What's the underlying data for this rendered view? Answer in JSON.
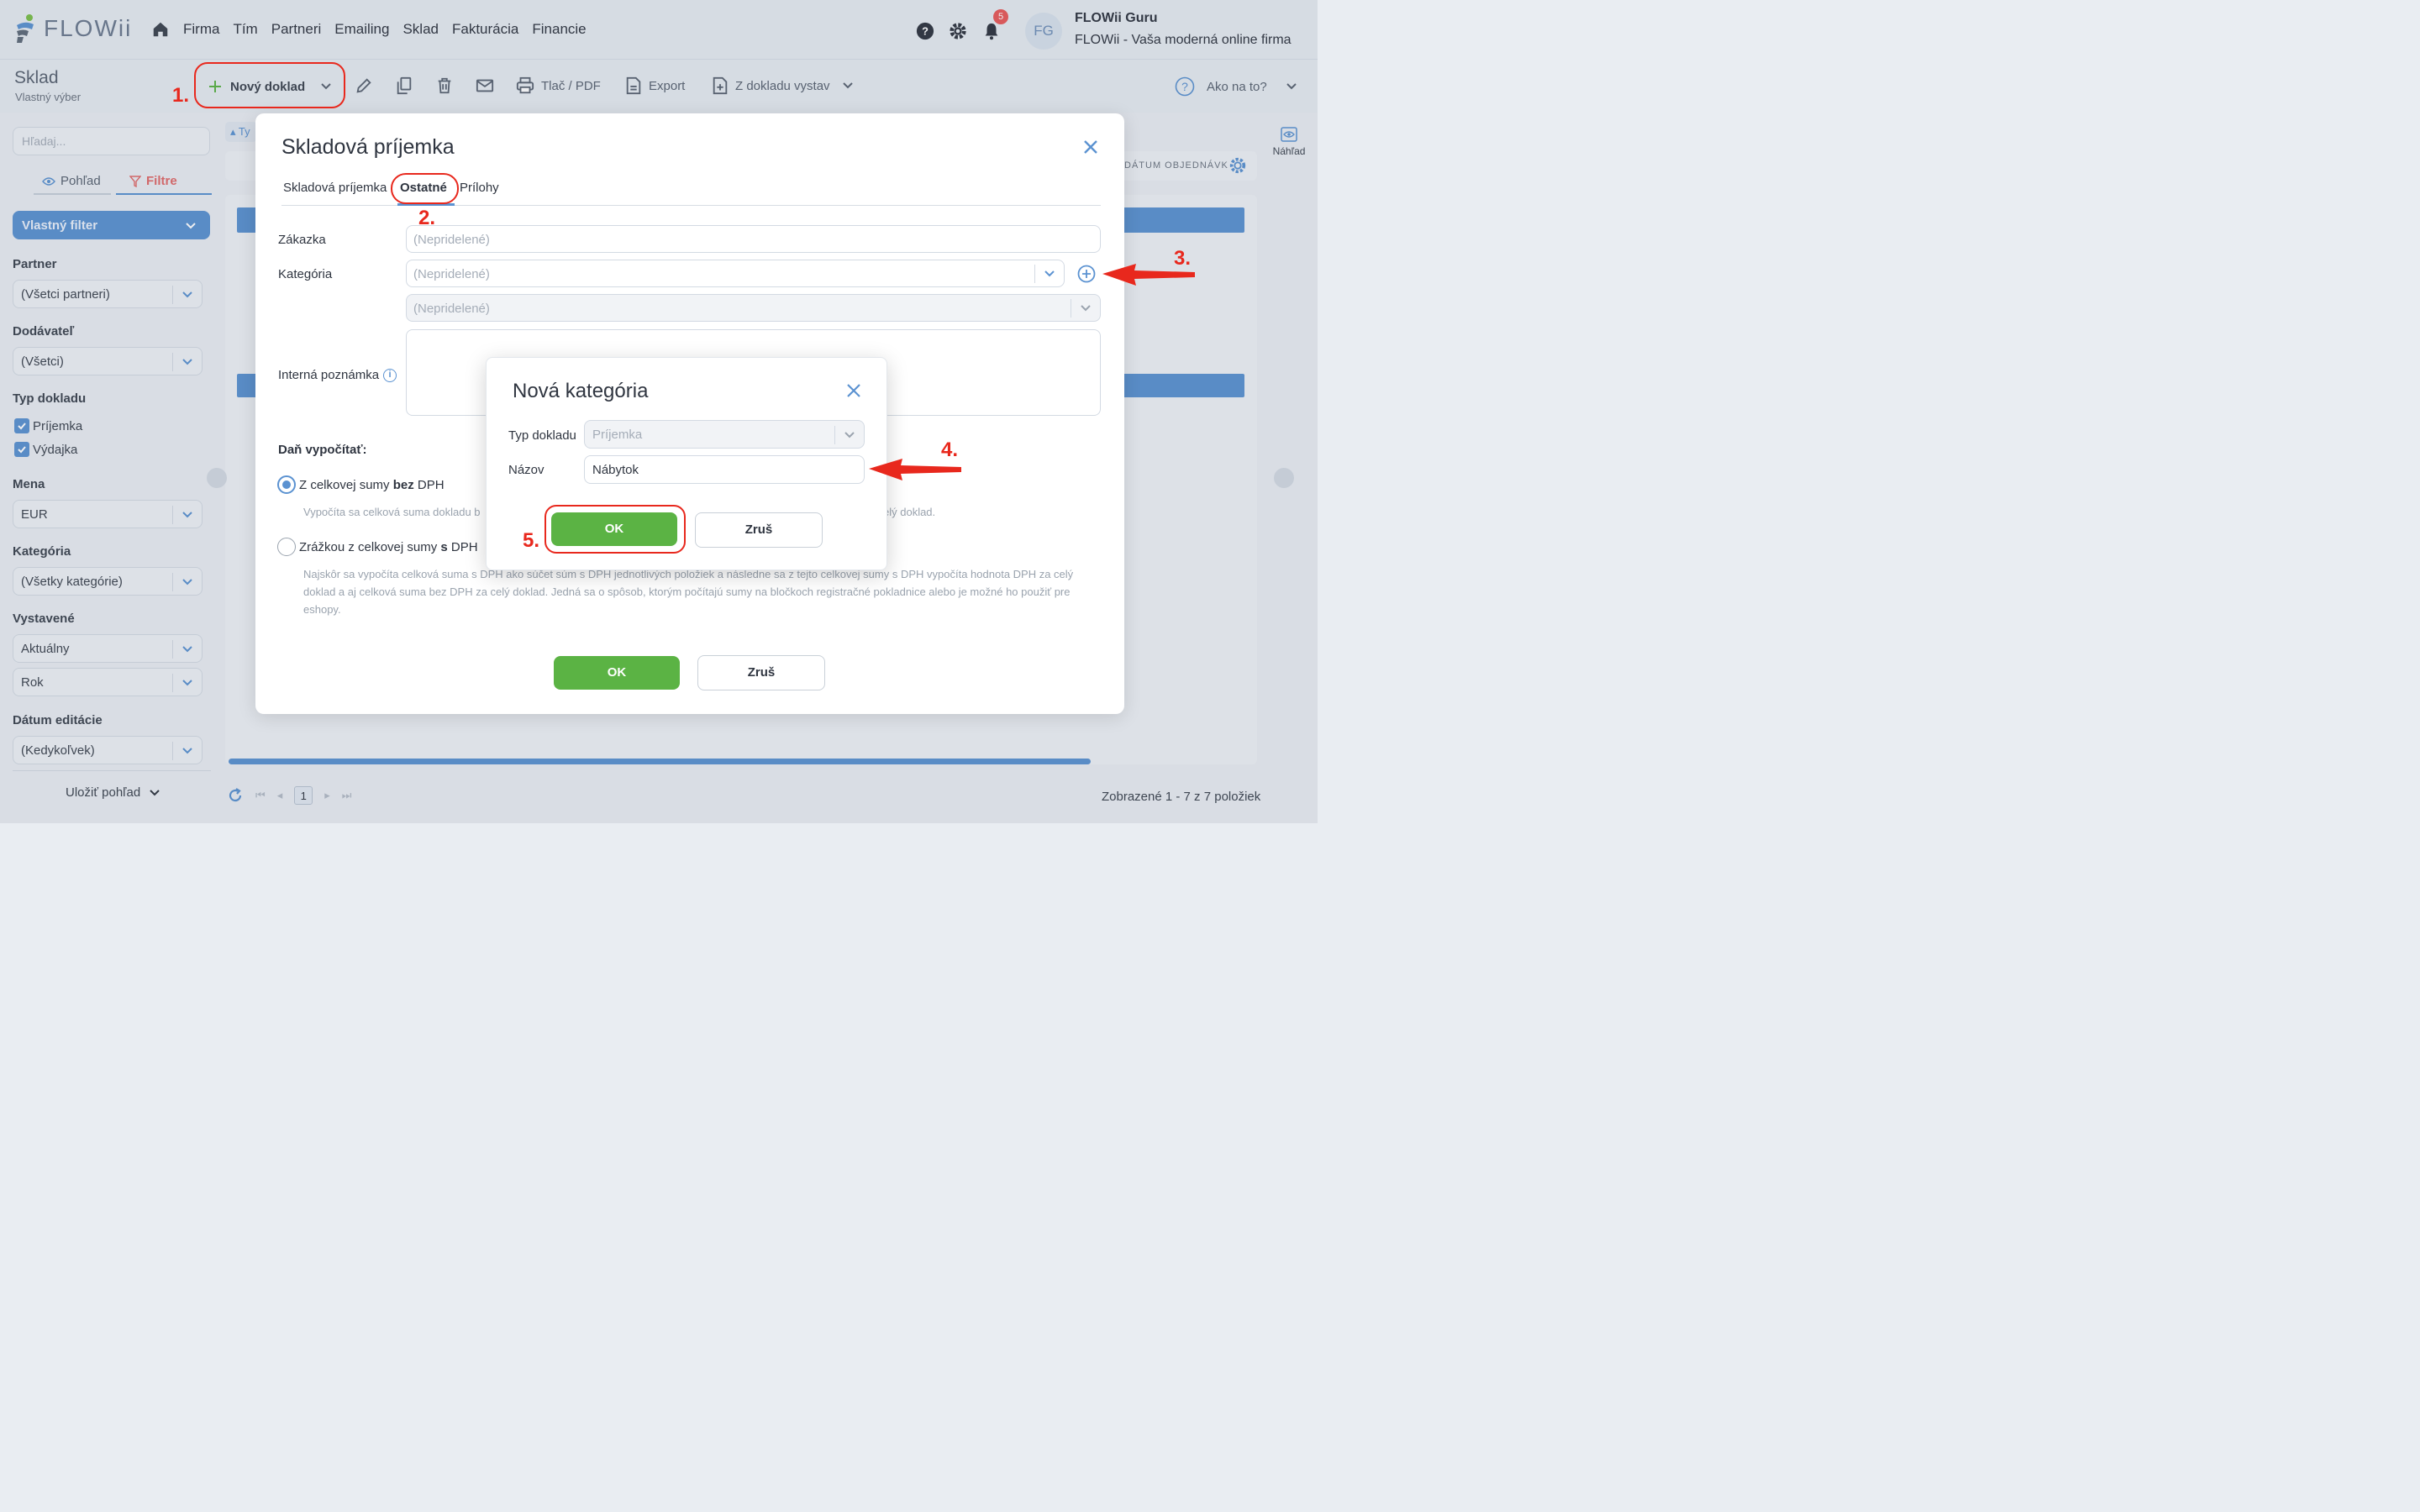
{
  "app": {
    "brand": "FLOWii",
    "nav": [
      "Firma",
      "Tím",
      "Partneri",
      "Emailing",
      "Sklad",
      "Fakturácia",
      "Financie"
    ],
    "notifications_count": "5",
    "user_initials": "FG",
    "user_name": "FLOWii Guru",
    "user_company": "FLOWii - Vaša moderná online firma"
  },
  "toolbar": {
    "page_title": "Sklad",
    "page_subtitle": "Vlastný výber",
    "new_doc": "Nový doklad",
    "print": "Tlač / PDF",
    "export": "Export",
    "from_doc": "Z dokladu vystav",
    "help": "Ako na to?"
  },
  "sidebar": {
    "search_placeholder": "Hľadaj...",
    "view_tab": "Pohľad",
    "filter_tab": "Filtre",
    "filter_name": "Vlastný filter",
    "partner_label": "Partner",
    "partner_value": "(Všetci partneri)",
    "supplier_label": "Dodávateľ",
    "supplier_value": "(Všetci)",
    "doc_type_label": "Typ dokladu",
    "doc_type_1": "Príjemka",
    "doc_type_2": "Výdajka",
    "currency_label": "Mena",
    "currency_value": "EUR",
    "category_label": "Kategória",
    "category_value": "(Všetky kategórie)",
    "issued_label": "Vystavené",
    "issued_value_1": "Aktuálny",
    "issued_value_2": "Rok",
    "edit_date_label": "Dátum editácie",
    "edit_date_value": "(Kedykoľvek)",
    "save_view": "Uložiť pohľad"
  },
  "grid": {
    "col_partial": "Ty",
    "col_order_date": "DÁTUM OBJEDNÁVK",
    "preview": "Náhľad",
    "page": "1",
    "count_text": "Zobrazené 1 - 7 z 7 položiek"
  },
  "modal": {
    "title": "Skladová príjemka",
    "tabs": [
      "Skladová príjemka",
      "Ostatné",
      "Prílohy"
    ],
    "order_label": "Zákazka",
    "order_placeholder": "(Nepridelené)",
    "category_label": "Kategória",
    "category_placeholder": "(Nepridelené)",
    "subcategory_placeholder": "(Nepridelené)",
    "note_label": "Interná poznámka",
    "tax_head": "Daň vypočítať:",
    "opt1_prefix": "Z celkovej sumy ",
    "opt1_bold": "bez",
    "opt1_suffix": " DPH",
    "opt1_hint_left": "Vypočíta sa celková suma dokladu b",
    "opt1_hint_right": "elý doklad.",
    "opt2_prefix": "Zrážkou z celkovej sumy ",
    "opt2_bold": "s",
    "opt2_suffix": " DPH",
    "opt2_hint": "Najskôr sa vypočíta celková suma s DPH ako súčet súm s DPH jednotlivých položiek a následne sa z tejto celkovej sumy s DPH vypočíta hodnota DPH za celý doklad a aj celková suma bez DPH za celý doklad. Jedná sa o spôsob, ktorým počítajú sumy na bločkoch registračné pokladnice alebo je možné ho použiť pre eshopy.",
    "ok": "OK",
    "cancel": "Zruš"
  },
  "submodal": {
    "title": "Nová kategória",
    "type_label": "Typ dokladu",
    "type_value": "Príjemka",
    "name_label": "Názov",
    "name_value": "Nábytok",
    "ok": "OK",
    "cancel": "Zruš"
  },
  "annotations": [
    "1.",
    "2.",
    "3.",
    "4.",
    "5."
  ],
  "colors": {
    "accent": "#5b92d1",
    "ok_green": "#5bb344",
    "annotation_red": "#e8281d"
  }
}
